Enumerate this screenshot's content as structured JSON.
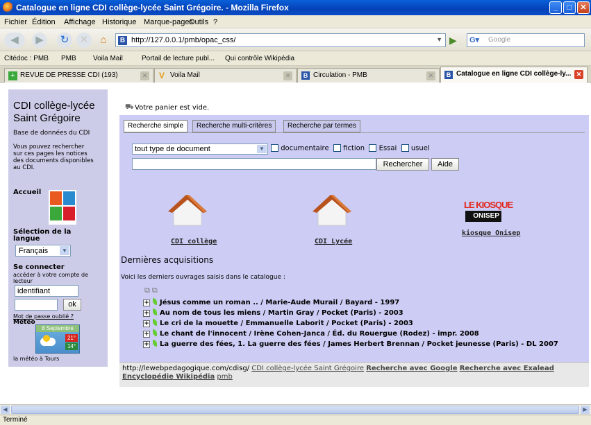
{
  "window": {
    "title": "Catalogue en ligne CDI collège-lycée Saint Grégoire. - Mozilla Firefox"
  },
  "menu": [
    "Fichier",
    "Édition",
    "Affichage",
    "Historique",
    "Marque-pages",
    "Outils",
    "?"
  ],
  "nav": {
    "url": "http://127.0.0.1/pmb/opac_css/",
    "search_placeholder": "Google"
  },
  "bookmarks": [
    "Citédoc : PMB",
    "PMB",
    "Voila Mail",
    "Portail de lecture publ...",
    "Qui contrôle Wikipédia"
  ],
  "tabs": [
    "REVUE DE PRESSE CDI (193)",
    "Voila Mail",
    "Circulation - PMB",
    "Catalogue en ligne CDI collège-ly..."
  ],
  "sidebar": {
    "title1": "CDI collège-lycée",
    "title2": "Saint Grégoire",
    "db": "Base de données du CDI",
    "intro": [
      "Vous pouvez rechercher",
      "sur ces pages les notices",
      "des documents disponibles",
      "au CDI."
    ],
    "accueil": "Accueil",
    "lang_title1": "Sélection de la",
    "lang_title2": "langue",
    "lang_value": "Français",
    "connect_title": "Se connecter",
    "connect_sub1": "accéder à votre compte de",
    "connect_sub2": "lecteur",
    "login_value": "identifiant",
    "ok": "ok",
    "forgot": "Mot de passe oublié ?",
    "meteo": "Météo",
    "date": "8 Septembre",
    "temp_max": "21°",
    "temp_min": "14°",
    "meteo_link": "la météo à Tours"
  },
  "main": {
    "basket": "Votre panier est vide.",
    "search_tabs": [
      "Recherche simple",
      "Recherche multi-critères",
      "Recherche par termes"
    ],
    "doc_type": "tout type de document",
    "checks": [
      "documentaire",
      "fiction",
      "Essai",
      "usuel"
    ],
    "search_btn": "Rechercher",
    "help_btn": "Aide",
    "links": [
      "CDI collège",
      "CDI Lycée",
      "kiosque Onisep"
    ],
    "kiosque_logo1": "LE KIOSQUE",
    "kiosque_logo2": "ONISEP",
    "acq_title": "Dernières acquisitions",
    "acq_intro": "Voici les derniers ouvrages saisis dans le catalogue :",
    "acquisitions": [
      "Jésus comme un roman .. / Marie-Aude Murail / Bayard - 1997",
      "Au nom de tous les miens / Martin Gray / Pocket (Paris) - 2003",
      "Le cri de la mouette / Emmanuelle Laborit / Pocket (Paris) - 2003",
      "Le chant de l'innocent / Irène Cohen-Janca / Éd. du Rouergue (Rodez) - impr. 2008",
      "La guerre des fées, 1. La guerre des fées / James Herbert Brennan / Pocket jeunesse (Paris) - DL 2007"
    ]
  },
  "footer": {
    "url": "http://lewebpedagogique.com/cdisg/",
    "l1": "CDI collège-lycée Saint Grégoire",
    "l2": "Recherche avec Google",
    "l3": "Recherche avec Exalead",
    "l4": "Encyclopédie Wikipédia",
    "l5": "pmb"
  },
  "status": "Terminé"
}
